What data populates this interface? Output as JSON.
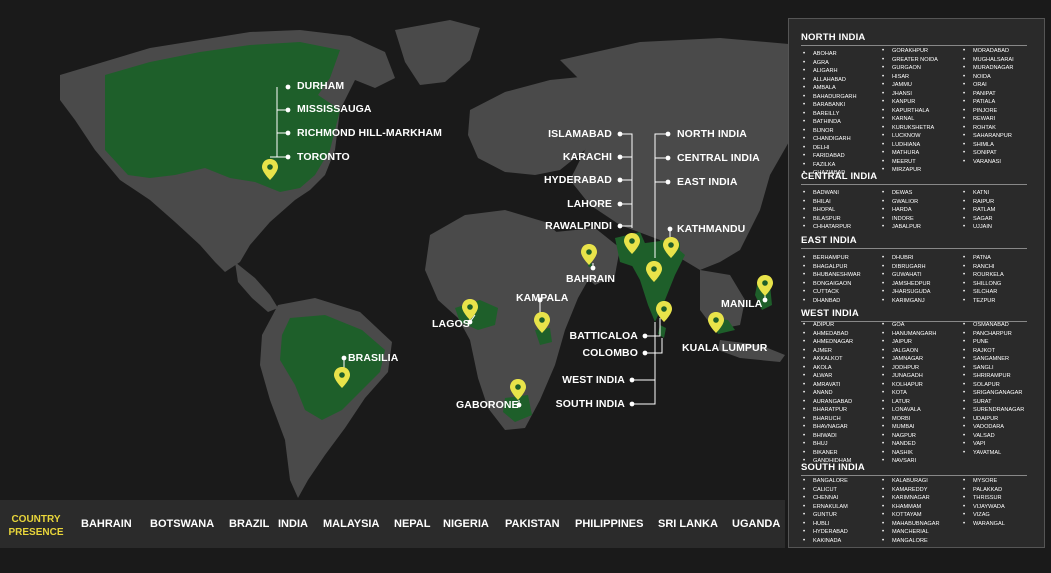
{
  "map": {
    "land_color": "#4a4a4a",
    "highlight_color": "#1e5f2a",
    "pin_color": "#e8e34a",
    "labels": {
      "durham": "DURHAM",
      "mississauga": "MISSISSAUGA",
      "richmond_hill": "RICHMOND HILL-MARKHAM",
      "toronto": "TORONTO",
      "islamabad": "ISLAMABAD",
      "karachi": "KARACHI",
      "hyderabad": "HYDERABAD",
      "lahore": "LAHORE",
      "rawalpindi": "RAWALPINDI",
      "north_india": "NORTH INDIA",
      "central_india": "CENTRAL INDIA",
      "east_india": "EAST INDIA",
      "kathmandu": "KATHMANDU",
      "bahrain": "BAHRAIN",
      "kampala": "KAMPALA",
      "lagos": "LAGOS",
      "brasilia": "BRASILIA",
      "batticaloa": "BATTICALOA",
      "colombo": "COLOMBO",
      "west_india": "WEST INDIA",
      "south_india": "SOUTH INDIA",
      "gaborone": "GABORONE",
      "manila": "MANILA",
      "kuala_lumpur": "KUALA LUMPUR"
    }
  },
  "bottom_bar": {
    "label_line1": "COUNTRY",
    "label_line2": "PRESENCE",
    "label_color": "#e8d53a",
    "countries": [
      "BAHRAIN",
      "BOTSWANA",
      "BRAZIL",
      "INDIA",
      "MALAYSIA",
      "NEPAL",
      "NIGERIA",
      "PAKISTAN",
      "PHILIPPINES",
      "SRI LANKA",
      "UGANDA"
    ]
  },
  "regions": [
    {
      "title": "NORTH INDIA",
      "columns": [
        [
          "ABOHAR",
          "AGRA",
          "ALIGARH",
          "ALLAHABAD",
          "AMBALA",
          "BAHADURGARH",
          "BARABANKI",
          "BAREILLY",
          "BATHINDA",
          "BIJNOR",
          "CHANDIGARH",
          "DELHI",
          "FARIDABAD",
          "FAZILKA",
          "GHAZIABAD"
        ],
        [
          "GORAKHPUR",
          "GREATER NOIDA",
          "GURGAON",
          "HISAR",
          "JAMMU",
          "JHANSI",
          "KANPUR",
          "KAPURTHALA",
          "KARNAL",
          "KURUKSHETRA",
          "LUCKNOW",
          "LUDHIANA",
          "MATHURA",
          "MEERUT",
          "MIRZAPUR"
        ],
        [
          "MORADABAD",
          "MUGHALSARAI",
          "MURADNAGAR",
          "NOIDA",
          "ORAI",
          "PANIPAT",
          "PATIALA",
          "PINJORE",
          "REWARI",
          "ROHTAK",
          "SAHARANPUR",
          "SHIMLA",
          "SONIPAT",
          "VARANASI"
        ]
      ]
    },
    {
      "title": "CENTRAL INDIA",
      "columns": [
        [
          "BADWANI",
          "BHILAI",
          "BHOPAL",
          "BILASPUR",
          "CHHATARPUR"
        ],
        [
          "DEWAS",
          "GWALIOR",
          "HARDA",
          "INDORE",
          "JABALPUR"
        ],
        [
          "KATNI",
          "RAIPUR",
          "RATLAM",
          "SAGAR",
          "UJJAIN"
        ]
      ]
    },
    {
      "title": "EAST INDIA",
      "columns": [
        [
          "BERHAMPUR",
          "BHAGALPUR",
          "BHUBANESHWAR",
          "BONGAIGAON",
          "CUTTACK",
          "DHANBAD"
        ],
        [
          "DHUBRI",
          "DIBRUGARH",
          "GUWAHATI",
          "JAMSHEDPUR",
          "JHARSUGUDA",
          "KARIMGANJ"
        ],
        [
          "PATNA",
          "RANCHI",
          "ROURKELA",
          "SHILLONG",
          "SILCHAR",
          "TEZPUR"
        ]
      ]
    },
    {
      "title": "WEST INDIA",
      "columns": [
        [
          "ADIPUR",
          "AHMEDABAD",
          "AHMEDNAGAR",
          "AJMER",
          "AKKALKOT",
          "AKOLA",
          "ALWAR",
          "AMRAVATI",
          "ANAND",
          "AURANGABAD",
          "BHARATPUR",
          "BHARUCH",
          "BHAVNAGAR",
          "BHIWADI",
          "BHUJ",
          "BIKANER",
          "GANDHIDHAM"
        ],
        [
          "GOA",
          "HANUMANGARH",
          "JAIPUR",
          "JALGAON",
          "JAMNAGAR",
          "JODHPUR",
          "JUNAGADH",
          "KOLHAPUR",
          "KOTA",
          "LATUR",
          "LONAVALA",
          "MORBI",
          "MUMBAI",
          "NAGPUR",
          "NANDED",
          "NASHIK",
          "NAVSARI"
        ],
        [
          "OSMANABAD",
          "PANCHARPUR",
          "PUNE",
          "RAJKOT",
          "SANGAMNER",
          "SANGLI",
          "SHRIRAMPUR",
          "SOLAPUR",
          "SRIGANGANAGAR",
          "SURAT",
          "SURENDRANAGAR",
          "UDAIPUR",
          "VADODARA",
          "VALSAD",
          "VAPI",
          "YAVATMAL"
        ]
      ]
    },
    {
      "title": "SOUTH INDIA",
      "columns": [
        [
          "BANGALORE",
          "CALICUT",
          "CHENNAI",
          "ERNAKULAM",
          "GUNTUR",
          "HUBLI",
          "HYDERABAD",
          "KAKINADA"
        ],
        [
          "KALABURAGI",
          "KAMAREDDY",
          "KARIMNAGAR",
          "KHAMMAM",
          "KOTTAYAM",
          "MAHABUBNAGAR",
          "MANCHERIAL",
          "MANGALORE"
        ],
        [
          "MYSORE",
          "PALAKKAD",
          "THRISSUR",
          "VIJAYWADA",
          "VIZAG",
          "WARANGAL"
        ]
      ]
    }
  ]
}
